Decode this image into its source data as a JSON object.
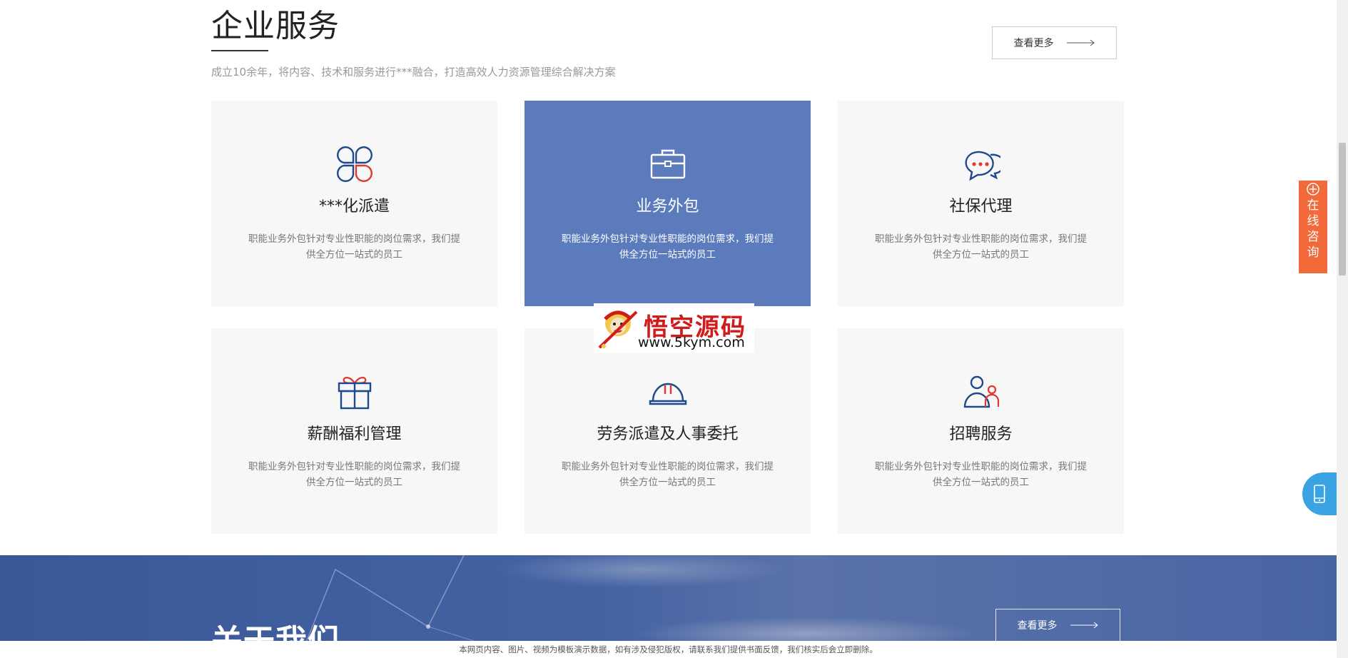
{
  "services": {
    "title": "企业服务",
    "subtitle": "成立10余年，将内容、技术和服务进行***融合，打造高效人力资源管理综合解决方案",
    "more_label": "查看更多",
    "cards": [
      {
        "title": "***化派遣",
        "desc": "职能业务外包针对专业性职能的岗位需求，我们提供全方位一站式的员工",
        "icon": "clover-icon",
        "active": false
      },
      {
        "title": "业务外包",
        "desc": "职能业务外包针对专业性职能的岗位需求，我们提供全方位一站式的员工",
        "icon": "briefcase-icon",
        "active": true
      },
      {
        "title": "社保代理",
        "desc": "职能业务外包针对专业性职能的岗位需求，我们提供全方位一站式的员工",
        "icon": "chat-bubbles-icon",
        "active": false
      },
      {
        "title": "薪酬福利管理",
        "desc": "职能业务外包针对专业性职能的岗位需求，我们提供全方位一站式的员工",
        "icon": "gift-icon",
        "active": false
      },
      {
        "title": "劳务派遣及人事委托",
        "desc": "职能业务外包针对专业性职能的岗位需求，我们提供全方位一站式的员工",
        "icon": "hard-hat-icon",
        "active": false
      },
      {
        "title": "招聘服务",
        "desc": "职能业务外包针对专业性职能的岗位需求，我们提供全方位一站式的员工",
        "icon": "users-icon",
        "active": false
      }
    ]
  },
  "watermark": {
    "brand": "悟空源码",
    "url": "www.5kym.com"
  },
  "about": {
    "title": "关于我们",
    "more_label": "查看更多"
  },
  "floating": {
    "consult_label": "在线咨询"
  },
  "notice": "本网页内容、图片、视频为模板演示数据，如有涉及侵犯版权，请联系我们提供书面反馈，我们核实后会立即删除。",
  "colors": {
    "accent_blue": "#5b7bbd",
    "icon_blue": "#1e4a8c",
    "icon_red": "#e0382c",
    "consult_orange": "#f2693a",
    "phone_blue": "#3aa3e3"
  }
}
